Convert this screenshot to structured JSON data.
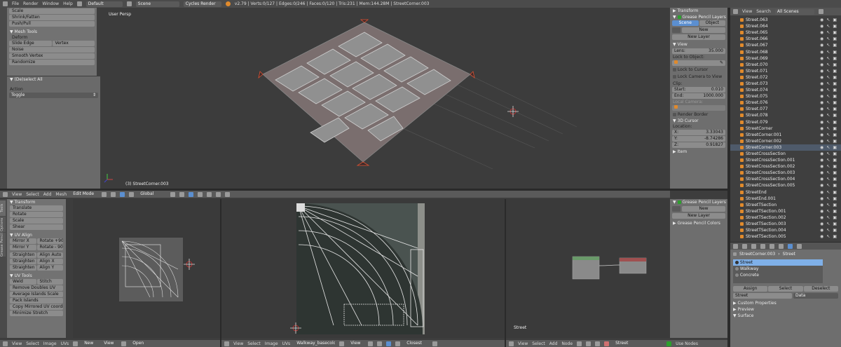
{
  "topbar": {
    "menus": [
      "File",
      "Render",
      "Window",
      "Help"
    ],
    "layout": "Default",
    "scene": "Scene",
    "engine": "Cycles Render",
    "stats": "v2.79 | Verts:0/127 | Edges:0/246 | Faces:0/120 | Tris:231 | Mem:144.28M | StreetCorner.003"
  },
  "left_tools": {
    "items_top": [
      "Scale",
      "Shrink/Fatten",
      "Push/Pull"
    ],
    "mesh_tools": "Mesh Tools",
    "deform": "Deform",
    "slide_edge": "Slide Edge",
    "vertex": "Vertex",
    "items": [
      "Noise",
      "Smooth Vertex",
      "Randomize"
    ],
    "op_title": "(De)select All",
    "action_label": "Action",
    "action_value": "Toggle"
  },
  "viewport": {
    "label": "User Persp",
    "object": "(3) StreetCorner.003"
  },
  "props_n": {
    "transform": "Transform",
    "gp_layers": "Grease Pencil Layers",
    "scene_btn": "Scene",
    "object_btn": "Object",
    "new_btn": "New",
    "new_layer_btn": "New Layer",
    "view": "View",
    "lens_label": "Lens:",
    "lens_value": "35.000",
    "lock_to_object": "Lock to Object:",
    "lock_to_cursor": "Lock to Cursor",
    "lock_camera": "Lock Camera to View",
    "clip": "Clip:",
    "clip_start_label": "Start:",
    "clip_start": "0.010",
    "clip_end_label": "End:",
    "clip_end": "1000.000",
    "local_camera": "Local Camera:",
    "render_border": "Render Border",
    "cursor_3d": "3D Cursor",
    "location": "Location:",
    "x_label": "X:",
    "x": "3.33043",
    "y_label": "Y:",
    "y": "-8.74286",
    "z_label": "Z:",
    "z": "0.91827",
    "item": "Item"
  },
  "outliner": {
    "menus": [
      "View",
      "Search"
    ],
    "filter": "All Scenes",
    "rows": [
      "Street.063",
      "Street.064",
      "Street.065",
      "Street.066",
      "Street.067",
      "Street.068",
      "Street.069",
      "Street.070",
      "Street.071",
      "Street.072",
      "Street.073",
      "Street.074",
      "Street.075",
      "Street.076",
      "Street.077",
      "Street.078",
      "Street.079",
      "StreetCorner",
      "StreetCorner.001",
      "StreetCorner.002",
      "StreetCorner.003",
      "StreetCrossSection",
      "StreetCrossSection.001",
      "StreetCrossSection.002",
      "StreetCrossSection.003",
      "StreetCrossSection.004",
      "StreetCrossSection.005",
      "StreetEnd",
      "StreetEnd.001",
      "StreetTSection",
      "StreetTSection.001",
      "StreetTSection.002",
      "StreetTSection.003",
      "StreetTSection.004",
      "StreetTSection.005"
    ]
  },
  "header3d": {
    "menus": [
      "View",
      "Select",
      "Add",
      "Mesh"
    ],
    "mode": "Edit Mode",
    "orientation": "Global"
  },
  "uv_tools": {
    "transform": "Transform",
    "items": [
      "Translate",
      "Rotate",
      "Scale",
      "Shear"
    ],
    "uv_align": "UV Align",
    "mirror_x": "Mirror X",
    "rotate_p90": "Rotate +90°",
    "mirror_y": "Mirror Y",
    "rotate_m90": "Rotate - 90°",
    "straighten": "Straighten",
    "align_auto": "Align Auto",
    "straighten_x": "Straighten X",
    "align_x": "Align X",
    "straighten_y": "Straighten Y",
    "align_y": "Align Y",
    "uv_tools_title": "UV Tools",
    "weld": "Weld",
    "stitch": "Stitch",
    "items2": [
      "Remove Doubles UV",
      "Average Islands Scale",
      "Pack Islands",
      "Copy Mirrored UV coords",
      "Minimize Stretch"
    ],
    "tabs": [
      "Tools",
      "Options",
      "Grease Pencil"
    ]
  },
  "uv_header": {
    "menus": [
      "View",
      "Select",
      "Image",
      "UVs"
    ],
    "new_btn": "New",
    "open_btn": "Open",
    "image_name": "Walkway_basecolor...",
    "snap": "Closest"
  },
  "img_header": {
    "menus": [
      "View",
      "Select",
      "Image",
      "UVs"
    ]
  },
  "node": {
    "label": "Street",
    "menus": [
      "View",
      "Select",
      "Add",
      "Node"
    ],
    "material": "Street",
    "use_nodes": "Use Nodes"
  },
  "node_props": {
    "gp_layers": "Grease Pencil Layers",
    "new_btn": "New",
    "new_layer_btn": "New Layer",
    "gp_colors": "Grease Pencil Colors"
  },
  "props": {
    "breadcrumb_obj": "StreetCorner.003",
    "breadcrumb_mat": "Street",
    "slots": [
      "Street",
      "Walkway",
      "Concrete"
    ],
    "assign": "Assign",
    "select": "Select",
    "deselect": "Deselect",
    "mat_name": "Street",
    "data": "Data",
    "sections": [
      "Custom Properties",
      "Preview",
      "Surface"
    ]
  }
}
